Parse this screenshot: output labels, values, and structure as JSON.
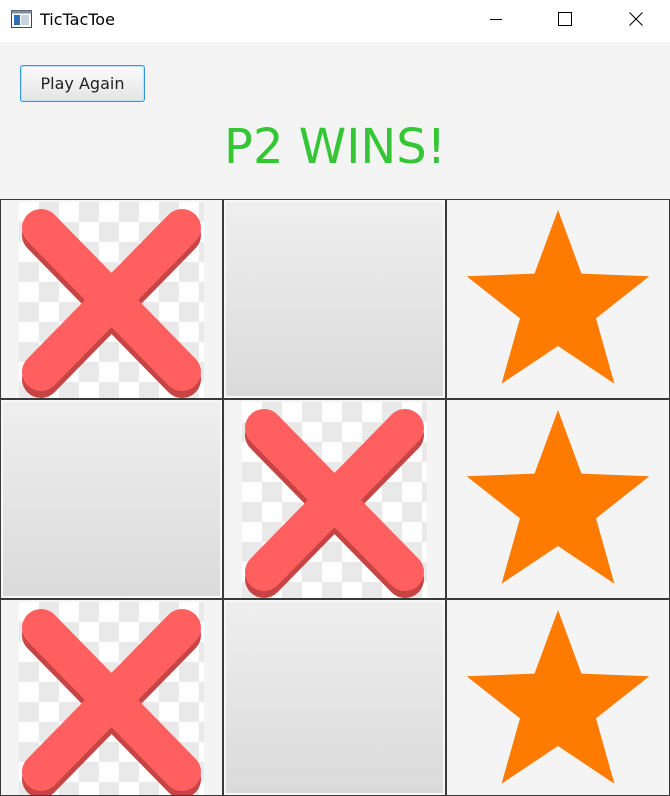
{
  "window": {
    "title": "TicTacToe",
    "icons": {
      "app": "app-window-icon",
      "minimize": "minimize-icon",
      "maximize": "maximize-icon",
      "close": "close-icon"
    }
  },
  "controls": {
    "play_again_label": "Play Again"
  },
  "status": {
    "text": "P2 WINS!",
    "color": "#34c634"
  },
  "board": {
    "cells": [
      "X",
      "",
      "STAR",
      "",
      "X",
      "STAR",
      "X",
      "",
      "STAR"
    ],
    "colors": {
      "x": "#ff5f5f",
      "x_shadow": "#c74444",
      "star": "#ff7b00"
    }
  }
}
